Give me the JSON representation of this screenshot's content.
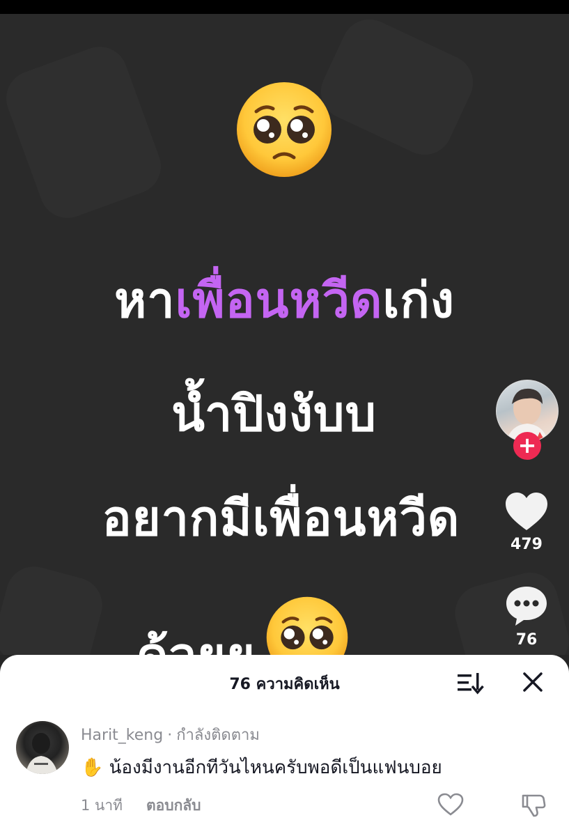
{
  "video": {
    "line1_prefix": "หา",
    "line1_accent": "เพื่อนหวีด",
    "line1_suffix": "เก่ง",
    "line2": "น้ำปิงงับบ",
    "line3": "อยากมีเพื่อนหวีด",
    "line4": "ด้วยย",
    "accent_color": "#c465f2",
    "emoji": "pleading-face"
  },
  "rail": {
    "follow_label": "+",
    "likes": "479",
    "comments": "76"
  },
  "comments_sheet": {
    "title": "76 ความคิดเห็น",
    "comment": {
      "username": "Harit_keng",
      "separator": "·",
      "status": "กำลังติดตาม",
      "text": "น้องมีงานอีกทีวันไหนครับพอดีเป็นแฟนบอย",
      "emoji": "✋",
      "time": "1 นาที",
      "reply_label": "ตอบกลับ"
    }
  }
}
